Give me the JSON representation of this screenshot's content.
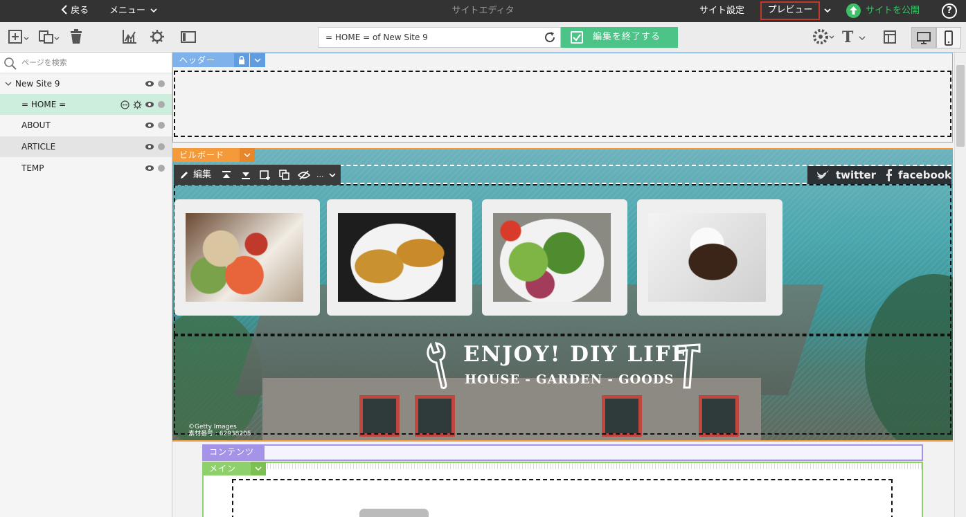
{
  "topbar": {
    "back": "戻る",
    "menu": "メニュー",
    "title": "サイトエディタ",
    "site_settings": "サイト設定",
    "preview": "プレビュー",
    "publish": "サイトを公開",
    "help": "?"
  },
  "toolbar": {
    "url": "= HOME = of New Site 9",
    "end_edit": "編集を終了する",
    "text_tool": "T"
  },
  "sidebar": {
    "search_placeholder": "ページを検索",
    "site": "New Site 9",
    "pages": [
      "= HOME =",
      "ABOUT",
      "ARTICLE",
      "TEMP"
    ]
  },
  "canvas": {
    "header_tag": "ヘッダー",
    "billboard_tag": "ビルボード",
    "content_tag": "コンテンツ",
    "main_tag": "メイン",
    "edit_label": "編集",
    "more_label": "...",
    "social": {
      "twitter": "twitter",
      "facebook": "facebook"
    },
    "logo_line1": "ENJOY! DIY LIFE",
    "logo_line2": "HOUSE - GARDEN - GOODS",
    "credit_line1": "©Getty Images",
    "credit_line2": "素材番号 : 62938205"
  },
  "colors": {
    "header_tag": "#7fb2ea",
    "billboard_tag": "#f59a3a",
    "content_tag": "#a593e8",
    "main_tag": "#8ed06b",
    "active_page": "#cdeedd",
    "publish": "#3cc067",
    "end_edit": "#4cc487"
  },
  "icons": [
    "back-chevron-icon",
    "chevron-down-icon",
    "add-section-icon",
    "duplicate-icon",
    "trash-icon",
    "analytics-icon",
    "gear-icon",
    "sidebar-toggle-icon",
    "refresh-icon",
    "check-icon",
    "theme-palette-icon",
    "text-icon",
    "layout-icon",
    "desktop-icon",
    "mobile-icon",
    "search-icon",
    "eye-icon",
    "lock-icon",
    "pencil-icon",
    "twitter-icon",
    "facebook-icon"
  ]
}
